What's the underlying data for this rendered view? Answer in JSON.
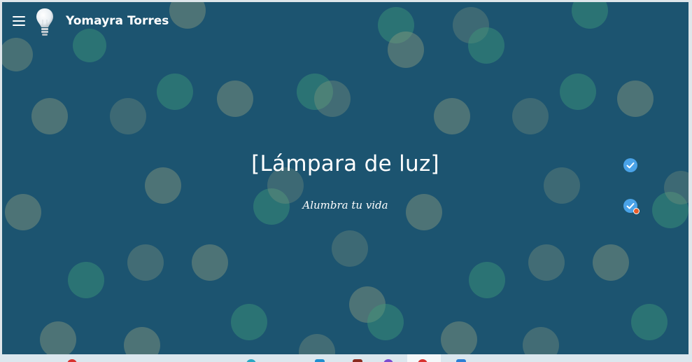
{
  "header": {
    "site_title": "Yomayra Torres",
    "menu_icon": "hamburger-menu-icon",
    "logo_icon": "light-bulb-icon"
  },
  "hero": {
    "title": "[Lámpara de luz]",
    "subtitle": "Alumbra tu vida"
  },
  "badges": {
    "icon": "checkmark-circle-icon",
    "color": "#4aa3e8",
    "notification_color": "#e85d2a"
  },
  "colors": {
    "background": "#1c5470",
    "text": "#ffffff"
  },
  "taskbar": {
    "item_text": "",
    "icons": [
      "red-circle-icon",
      "teal-app-icon",
      "blue-app-icon",
      "dark-red-app-icon",
      "purple-app-icon",
      "red-app-icon",
      "blue-app-icon-2"
    ]
  }
}
